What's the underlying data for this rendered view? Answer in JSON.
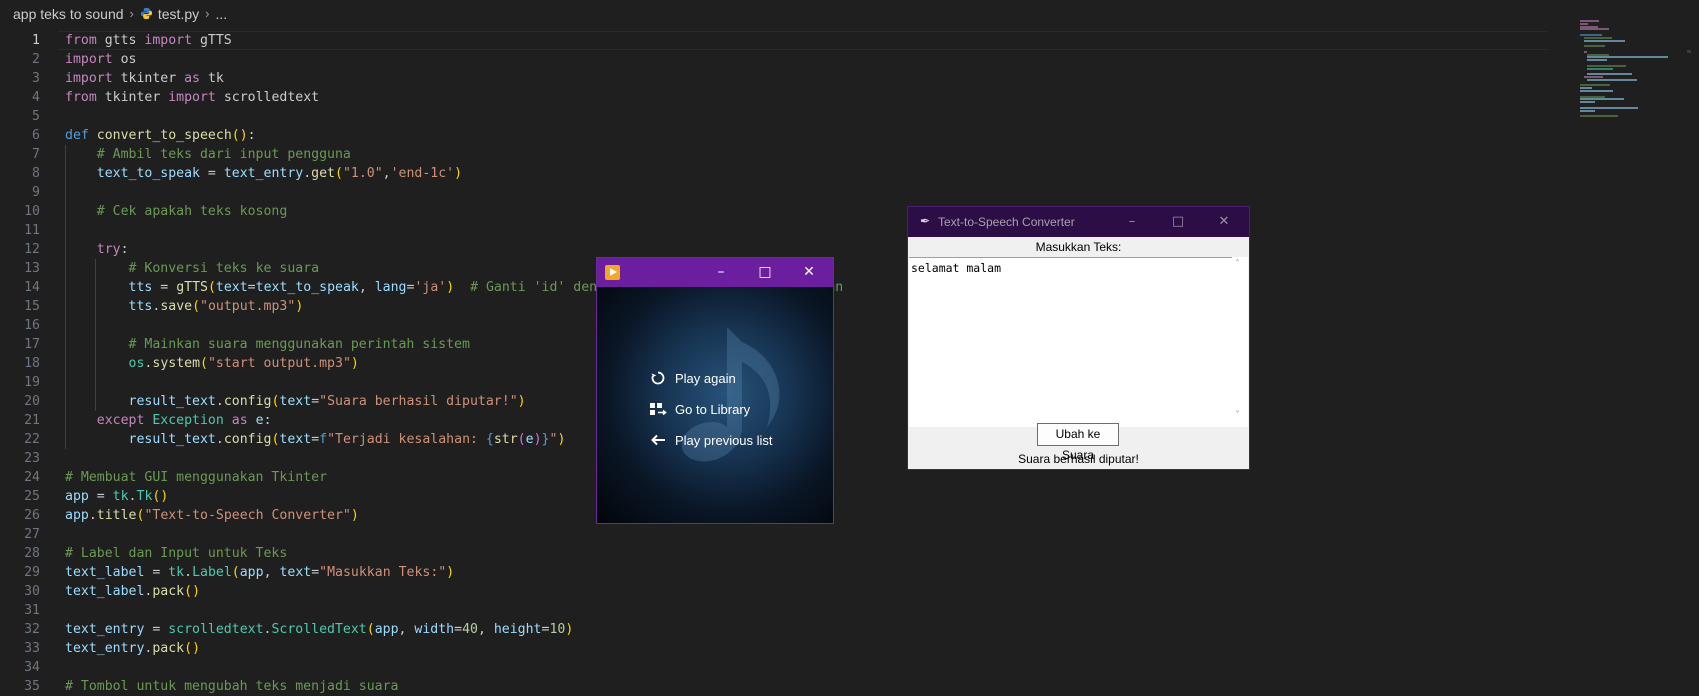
{
  "breadcrumb": {
    "folder": "app teks to sound",
    "file": "test.py",
    "more": "..."
  },
  "active_line": 1,
  "code_lines": [
    {
      "n": "1",
      "tokens": [
        [
          "kw",
          "from"
        ],
        [
          "",
          " gtts "
        ],
        [
          "kw",
          "import"
        ],
        [
          "",
          " gTTS"
        ]
      ]
    },
    {
      "n": "2",
      "tokens": [
        [
          "kw",
          "import"
        ],
        [
          "",
          " os"
        ]
      ]
    },
    {
      "n": "3",
      "tokens": [
        [
          "kw",
          "import"
        ],
        [
          "",
          " tkinter "
        ],
        [
          "kw",
          "as"
        ],
        [
          "",
          " tk"
        ]
      ]
    },
    {
      "n": "4",
      "tokens": [
        [
          "kw",
          "from"
        ],
        [
          "",
          " tkinter "
        ],
        [
          "kw",
          "import"
        ],
        [
          "",
          " scrolledtext"
        ]
      ]
    },
    {
      "n": "5",
      "tokens": []
    },
    {
      "n": "6",
      "tokens": [
        [
          "kwb",
          "def"
        ],
        [
          "",
          " "
        ],
        [
          "fn",
          "convert_to_speech"
        ],
        [
          "br1",
          "()"
        ],
        [
          "",
          ":"
        ]
      ]
    },
    {
      "n": "7",
      "tokens": [
        [
          "",
          "    "
        ],
        [
          "cm",
          "# Ambil teks dari input pengguna"
        ]
      ]
    },
    {
      "n": "8",
      "tokens": [
        [
          "",
          "    "
        ],
        [
          "var",
          "text_to_speak"
        ],
        [
          "",
          " = "
        ],
        [
          "var",
          "text_entry"
        ],
        [
          "",
          "."
        ],
        [
          "fn",
          "get"
        ],
        [
          "br1",
          "("
        ],
        [
          "str",
          "\"1.0\""
        ],
        [
          "",
          ","
        ],
        [
          "str",
          "'end-1c'"
        ],
        [
          "br1",
          ")"
        ]
      ]
    },
    {
      "n": "9",
      "tokens": []
    },
    {
      "n": "10",
      "tokens": [
        [
          "",
          "    "
        ],
        [
          "cm",
          "# Cek apakah teks kosong"
        ]
      ]
    },
    {
      "n": "11",
      "tokens": []
    },
    {
      "n": "12",
      "tokens": [
        [
          "",
          "    "
        ],
        [
          "kw",
          "try"
        ],
        [
          "",
          ":"
        ]
      ]
    },
    {
      "n": "13",
      "tokens": [
        [
          "",
          "        "
        ],
        [
          "cm",
          "# Konversi teks ke suara"
        ]
      ]
    },
    {
      "n": "14",
      "tokens": [
        [
          "",
          "        "
        ],
        [
          "var",
          "tts"
        ],
        [
          "",
          " = "
        ],
        [
          "fn",
          "gTTS"
        ],
        [
          "br1",
          "("
        ],
        [
          "var",
          "text"
        ],
        [
          "",
          "="
        ],
        [
          "var",
          "text_to_speak"
        ],
        [
          "",
          ", "
        ],
        [
          "var",
          "lang"
        ],
        [
          "",
          "="
        ],
        [
          "str",
          "'ja'"
        ],
        [
          "br1",
          ")"
        ],
        [
          "",
          "  "
        ],
        [
          "cm",
          "# Ganti 'id' dengan kode bahasa yang diinginkan"
        ]
      ]
    },
    {
      "n": "15",
      "tokens": [
        [
          "",
          "        "
        ],
        [
          "var",
          "tts"
        ],
        [
          "",
          "."
        ],
        [
          "fn",
          "save"
        ],
        [
          "br1",
          "("
        ],
        [
          "str",
          "\"output.mp3\""
        ],
        [
          "br1",
          ")"
        ]
      ]
    },
    {
      "n": "16",
      "tokens": []
    },
    {
      "n": "17",
      "tokens": [
        [
          "",
          "        "
        ],
        [
          "cm",
          "# Mainkan suara menggunakan perintah sistem"
        ]
      ]
    },
    {
      "n": "18",
      "tokens": [
        [
          "",
          "        "
        ],
        [
          "cls",
          "os"
        ],
        [
          "",
          "."
        ],
        [
          "fn",
          "system"
        ],
        [
          "br1",
          "("
        ],
        [
          "str",
          "\"start output.mp3\""
        ],
        [
          "br1",
          ")"
        ]
      ]
    },
    {
      "n": "19",
      "tokens": []
    },
    {
      "n": "20",
      "tokens": [
        [
          "",
          "        "
        ],
        [
          "var",
          "result_text"
        ],
        [
          "",
          "."
        ],
        [
          "fn",
          "config"
        ],
        [
          "br1",
          "("
        ],
        [
          "var",
          "text"
        ],
        [
          "",
          "="
        ],
        [
          "str",
          "\"Suara berhasil diputar!\""
        ],
        [
          "br1",
          ")"
        ]
      ]
    },
    {
      "n": "21",
      "tokens": [
        [
          "",
          "    "
        ],
        [
          "kw",
          "except"
        ],
        [
          "",
          " "
        ],
        [
          "cls",
          "Exception"
        ],
        [
          "",
          " "
        ],
        [
          "kw",
          "as"
        ],
        [
          "",
          " "
        ],
        [
          "var",
          "e"
        ],
        [
          "",
          ":"
        ]
      ]
    },
    {
      "n": "22",
      "tokens": [
        [
          "",
          "        "
        ],
        [
          "var",
          "result_text"
        ],
        [
          "",
          "."
        ],
        [
          "fn",
          "config"
        ],
        [
          "br1",
          "("
        ],
        [
          "var",
          "text"
        ],
        [
          "",
          "="
        ],
        [
          "kwb",
          "f"
        ],
        [
          "str",
          "\"Terjadi kesalahan: "
        ],
        [
          "kwb",
          "{"
        ],
        [
          "fn",
          "str"
        ],
        [
          "br2",
          "("
        ],
        [
          "var",
          "e"
        ],
        [
          "br2",
          ")"
        ],
        [
          "kwb",
          "}"
        ],
        [
          "str",
          "\""
        ],
        [
          "br1",
          ")"
        ]
      ]
    },
    {
      "n": "23",
      "tokens": []
    },
    {
      "n": "24",
      "tokens": [
        [
          "cm",
          "# Membuat GUI menggunakan Tkinter"
        ]
      ]
    },
    {
      "n": "25",
      "tokens": [
        [
          "var",
          "app"
        ],
        [
          "",
          " = "
        ],
        [
          "cls",
          "tk"
        ],
        [
          "",
          "."
        ],
        [
          "cls",
          "Tk"
        ],
        [
          "br1",
          "()"
        ]
      ]
    },
    {
      "n": "26",
      "tokens": [
        [
          "var",
          "app"
        ],
        [
          "",
          "."
        ],
        [
          "fn",
          "title"
        ],
        [
          "br1",
          "("
        ],
        [
          "str",
          "\"Text-to-Speech Converter\""
        ],
        [
          "br1",
          ")"
        ]
      ]
    },
    {
      "n": "27",
      "tokens": []
    },
    {
      "n": "28",
      "tokens": [
        [
          "cm",
          "# Label dan Input untuk Teks"
        ]
      ]
    },
    {
      "n": "29",
      "tokens": [
        [
          "var",
          "text_label"
        ],
        [
          "",
          " = "
        ],
        [
          "cls",
          "tk"
        ],
        [
          "",
          "."
        ],
        [
          "cls",
          "Label"
        ],
        [
          "br1",
          "("
        ],
        [
          "var",
          "app"
        ],
        [
          "",
          ", "
        ],
        [
          "var",
          "text"
        ],
        [
          "",
          "="
        ],
        [
          "str",
          "\"Masukkan Teks:\""
        ],
        [
          "br1",
          ")"
        ]
      ]
    },
    {
      "n": "30",
      "tokens": [
        [
          "var",
          "text_label"
        ],
        [
          "",
          "."
        ],
        [
          "fn",
          "pack"
        ],
        [
          "br1",
          "()"
        ]
      ]
    },
    {
      "n": "31",
      "tokens": []
    },
    {
      "n": "32",
      "tokens": [
        [
          "var",
          "text_entry"
        ],
        [
          "",
          " = "
        ],
        [
          "cls",
          "scrolledtext"
        ],
        [
          "",
          "."
        ],
        [
          "cls",
          "ScrolledText"
        ],
        [
          "br1",
          "("
        ],
        [
          "var",
          "app"
        ],
        [
          "",
          ", "
        ],
        [
          "var",
          "width"
        ],
        [
          "",
          "="
        ],
        [
          "num",
          "40"
        ],
        [
          "",
          ", "
        ],
        [
          "var",
          "height"
        ],
        [
          "",
          "="
        ],
        [
          "num",
          "10"
        ],
        [
          "br1",
          ")"
        ]
      ]
    },
    {
      "n": "33",
      "tokens": [
        [
          "var",
          "text_entry"
        ],
        [
          "",
          "."
        ],
        [
          "fn",
          "pack"
        ],
        [
          "br1",
          "()"
        ]
      ]
    },
    {
      "n": "34",
      "tokens": []
    },
    {
      "n": "35",
      "tokens": [
        [
          "cm",
          "# Tombol untuk mengubah teks menjadi suara"
        ]
      ]
    }
  ],
  "media_player": {
    "menu": [
      {
        "label": "Play again",
        "icon": "replay-icon"
      },
      {
        "label": "Go to Library",
        "icon": "library-icon"
      },
      {
        "label": "Play previous list",
        "icon": "back-arrow-icon"
      }
    ]
  },
  "tk_app": {
    "title": "Text-to-Speech Converter",
    "label": "Masukkan Teks:",
    "text_value": "selamat malam",
    "button": "Ubah ke Suara",
    "result": "Suara berhasil diputar!"
  },
  "colors": {
    "editor_bg": "#1f1f1f",
    "title_purple": "#6b1f9e",
    "tk_title": "#2d0d45"
  }
}
